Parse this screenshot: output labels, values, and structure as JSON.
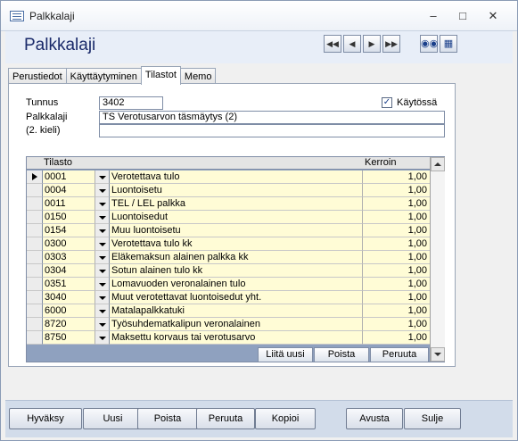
{
  "window": {
    "title": "Palkkalaji"
  },
  "header": {
    "form_title": "Palkkalaji",
    "nav_buttons": [
      "first-record",
      "previous-record",
      "next-record",
      "last-record"
    ],
    "tools": [
      "binoculars-icon",
      "datasheet-icon"
    ]
  },
  "tabs": [
    {
      "label": "Perustiedot",
      "active": false
    },
    {
      "label": "Käyttäytyminen",
      "active": false
    },
    {
      "label": "Tilastot",
      "active": true
    },
    {
      "label": "Memo",
      "active": false
    }
  ],
  "form": {
    "tunnus_label": "Tunnus",
    "tunnus_value": "3402",
    "palkkalaji_label": "Palkkalaji",
    "palkkalaji_value": "TS Verotusarvon täsmäytys (2)",
    "kieli2_label": "(2. kieli)",
    "kieli2_value": "",
    "kaytossa_label": "Käytössä",
    "kaytossa_checked": "✓"
  },
  "grid": {
    "col_tilasto": "Tilasto",
    "col_kerroin": "Kerroin",
    "rows": [
      {
        "code": "0001",
        "name": "Verotettava tulo",
        "value": "1,00"
      },
      {
        "code": "0004",
        "name": "Luontoisetu",
        "value": "1,00"
      },
      {
        "code": "0011",
        "name": "TEL / LEL palkka",
        "value": "1,00"
      },
      {
        "code": "0150",
        "name": "Luontoisedut",
        "value": "1,00"
      },
      {
        "code": "0154",
        "name": "Muu luontoisetu",
        "value": "1,00"
      },
      {
        "code": "0300",
        "name": "Verotettava tulo kk",
        "value": "1,00"
      },
      {
        "code": "0303",
        "name": "Eläkemaksun alainen palkka kk",
        "value": "1,00"
      },
      {
        "code": "0304",
        "name": "Sotun alainen tulo kk",
        "value": "1,00"
      },
      {
        "code": "0351",
        "name": "Lomavuoden veronalainen tulo",
        "value": "1,00"
      },
      {
        "code": "3040",
        "name": "Muut verotettavat luontoisedut yht.",
        "value": "1,00"
      },
      {
        "code": "6000",
        "name": "Matalapalkkatuki",
        "value": "1,00"
      },
      {
        "code": "8720",
        "name": "Työsuhdematkalipun veronalainen",
        "value": "1,00"
      },
      {
        "code": "8750",
        "name": "Maksettu korvaus tai verotusarvo",
        "value": "1,00"
      }
    ],
    "btn_liita": "Liitä uusi",
    "btn_poista": "Poista",
    "btn_peruuta": "Peruuta"
  },
  "footer": {
    "hyvaksy": "Hyväksy",
    "uusi": "Uusi",
    "poista": "Poista",
    "peruuta": "Peruuta",
    "kopioi": "Kopioi",
    "avusta": "Avusta",
    "sulje": "Sulje"
  }
}
